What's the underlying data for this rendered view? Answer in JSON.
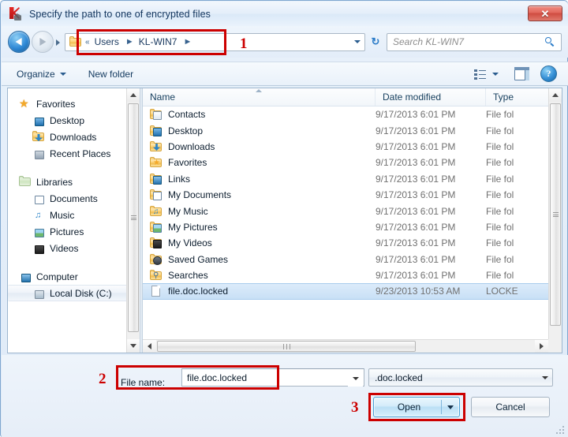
{
  "window": {
    "title": "Specify the path to one of encrypted files",
    "app_icon": "kaspersky-k-icon",
    "close_label": "✕"
  },
  "navbar": {
    "back_icon": "back-arrow-icon",
    "forward_icon": "forward-arrow-icon",
    "breadcrumb": {
      "folder_icon": "folder-icon",
      "chevrons": "«",
      "items": [
        {
          "label": "Users",
          "sep": "►"
        },
        {
          "label": "KL-WIN7",
          "sep": "►"
        }
      ]
    },
    "dropdown_icon": "chevron-down-icon",
    "refresh_icon": "refresh-icon",
    "refresh_glyph": "↻",
    "search": {
      "placeholder": "Search KL-WIN7",
      "icon": "search-icon"
    }
  },
  "toolbar": {
    "organize_label": "Organize",
    "organize_caret_icon": "chevron-down-icon",
    "new_folder_label": "New folder",
    "views_icon": "views-list-icon",
    "views_caret_icon": "chevron-down-icon",
    "preview_pane_icon": "preview-pane-icon",
    "help_icon": "help-icon",
    "help_glyph": "?"
  },
  "sidebar": {
    "groups": [
      {
        "header": {
          "label": "Favorites",
          "icon": "star-icon"
        },
        "items": [
          {
            "label": "Desktop",
            "icon": "desktop-icon"
          },
          {
            "label": "Downloads",
            "icon": "downloads-icon"
          },
          {
            "label": "Recent Places",
            "icon": "recent-places-icon"
          }
        ]
      },
      {
        "header": {
          "label": "Libraries",
          "icon": "libraries-icon"
        },
        "items": [
          {
            "label": "Documents",
            "icon": "documents-icon"
          },
          {
            "label": "Music",
            "icon": "music-icon"
          },
          {
            "label": "Pictures",
            "icon": "pictures-icon"
          },
          {
            "label": "Videos",
            "icon": "videos-icon"
          }
        ]
      },
      {
        "header": {
          "label": "Computer",
          "icon": "computer-icon"
        },
        "items": [
          {
            "label": "Local Disk (C:)",
            "icon": "disk-icon",
            "selected": true
          }
        ]
      }
    ]
  },
  "filelist": {
    "columns": [
      {
        "label": "Name"
      },
      {
        "label": "Date modified"
      },
      {
        "label": "Type"
      }
    ],
    "rows": [
      {
        "name": "Contacts",
        "date": "9/17/2013 6:01 PM",
        "type": "File fol",
        "icon": "folder-contacts-icon"
      },
      {
        "name": "Desktop",
        "date": "9/17/2013 6:01 PM",
        "type": "File fol",
        "icon": "folder-desktop-icon"
      },
      {
        "name": "Downloads",
        "date": "9/17/2013 6:01 PM",
        "type": "File fol",
        "icon": "folder-downloads-icon"
      },
      {
        "name": "Favorites",
        "date": "9/17/2013 6:01 PM",
        "type": "File fol",
        "icon": "folder-favorites-icon"
      },
      {
        "name": "Links",
        "date": "9/17/2013 6:01 PM",
        "type": "File fol",
        "icon": "folder-links-icon"
      },
      {
        "name": "My Documents",
        "date": "9/17/2013 6:01 PM",
        "type": "File fol",
        "icon": "folder-documents-icon"
      },
      {
        "name": "My Music",
        "date": "9/17/2013 6:01 PM",
        "type": "File fol",
        "icon": "folder-music-icon"
      },
      {
        "name": "My Pictures",
        "date": "9/17/2013 6:01 PM",
        "type": "File fol",
        "icon": "folder-pictures-icon"
      },
      {
        "name": "My Videos",
        "date": "9/17/2013 6:01 PM",
        "type": "File fol",
        "icon": "folder-videos-icon"
      },
      {
        "name": "Saved Games",
        "date": "9/17/2013 6:01 PM",
        "type": "File fol",
        "icon": "folder-games-icon"
      },
      {
        "name": "Searches",
        "date": "9/17/2013 6:01 PM",
        "type": "File fol",
        "icon": "folder-searches-icon"
      },
      {
        "name": "file.doc.locked",
        "date": "9/23/2013 10:53 AM",
        "type": "LOCKE",
        "icon": "document-icon",
        "selected": true
      }
    ]
  },
  "bottom": {
    "filename_label": "File name:",
    "filename_value": "file.doc.locked",
    "filename_dropdown_icon": "chevron-down-icon",
    "filter_value": ".doc.locked",
    "filter_dropdown_icon": "chevron-down-icon",
    "open_label": "Open",
    "open_split_icon": "chevron-down-icon",
    "cancel_label": "Cancel"
  },
  "annotations": {
    "markers": [
      {
        "number": "1",
        "target": "address-bar"
      },
      {
        "number": "2",
        "target": "filename-field"
      },
      {
        "number": "3",
        "target": "open-button"
      }
    ],
    "color": "#cc0000"
  }
}
